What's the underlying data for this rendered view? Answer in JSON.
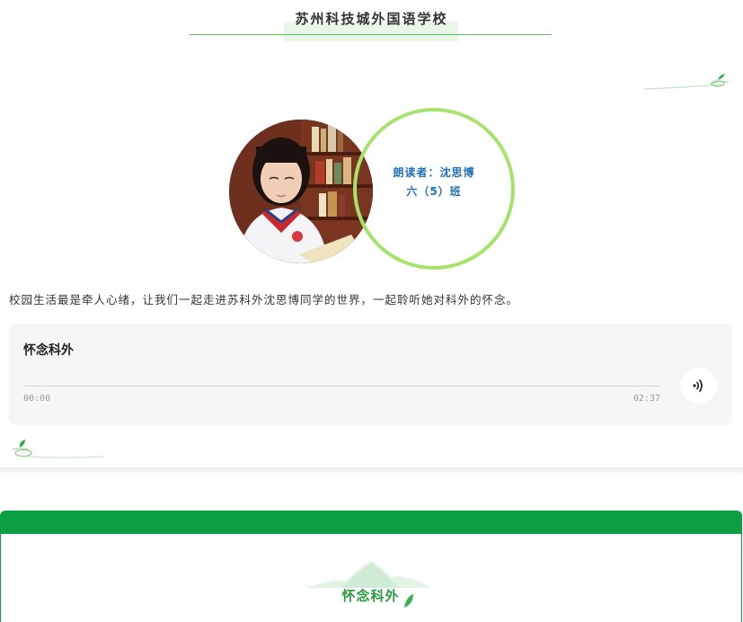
{
  "header": {
    "school_name": "苏州科技城外国语学校"
  },
  "reader": {
    "name_line": "朗读者：沈思博",
    "class_line": "六（5）班"
  },
  "intro_text": "校园生活最是牵人心绪，让我们一起走进苏科外沈思博同学的世界，一起聆听她对科外的怀念。",
  "player": {
    "title": "怀念科外",
    "current_time": "00:00",
    "total_time": "02:37",
    "progress": 0
  },
  "section": {
    "title": "怀念科外"
  },
  "colors": {
    "accent_green": "#0d9f44",
    "ring_green": "#a6e36a",
    "reader_blue": "#1f6fb8"
  }
}
